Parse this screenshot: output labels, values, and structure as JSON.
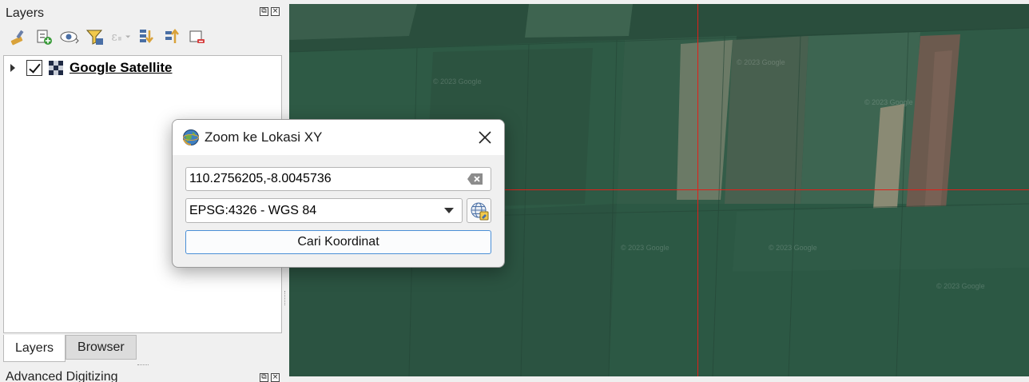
{
  "layers_panel": {
    "title": "Layers",
    "toolbar_icons": [
      "style-manager-icon",
      "add-group-icon",
      "manage-visibility-icon",
      "filter-legend-icon",
      "filter-expression-icon",
      "expand-all-icon",
      "collapse-all-icon",
      "remove-layer-icon"
    ],
    "layers": [
      {
        "name": "Google Satellite",
        "checked": true,
        "type": "raster"
      }
    ],
    "tabs": [
      {
        "label": "Layers",
        "active": true
      },
      {
        "label": "Browser",
        "active": false
      }
    ]
  },
  "advanced_panel": {
    "title": "Advanced Digitizing"
  },
  "dialog": {
    "title": "Zoom ke Lokasi XY",
    "coordinate_value": "110.2756205,-8.0045736",
    "crs_selected": "EPSG:4326 - WGS 84",
    "search_button_label": "Cari Koordinat"
  },
  "map": {
    "crosshair_color": "#e0201a",
    "watermark_text": "© 2023 Google"
  }
}
